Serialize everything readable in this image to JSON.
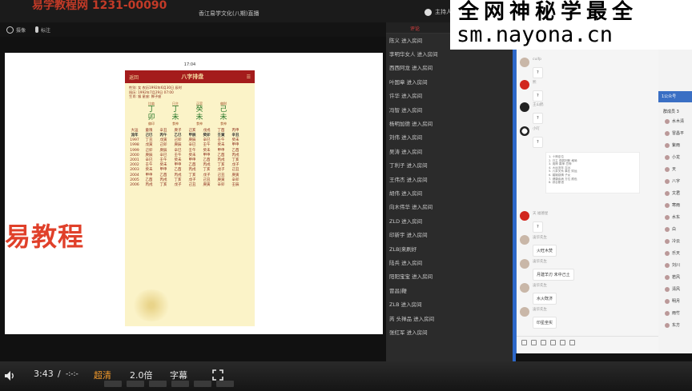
{
  "top": {
    "watermark_text": "易学教程网 1231-00090",
    "title": "香江易学文化(八期)直播",
    "user": "主持人直播中"
  },
  "video_toolbar": {
    "camera_label": "摄像",
    "pin_label": "标注"
  },
  "overlay": {
    "big_text": "易教程"
  },
  "phone": {
    "status_time": "17:04",
    "header_title": "八字排盘",
    "back_label": "返回",
    "lines": [
      "性别: 女  农历1992年6月30日 辰时",
      "阳历: 1992年7月29日 07:00",
      "生肖: 猴  星座: 狮子座"
    ],
    "pillars": [
      {
        "sub": "比肩",
        "gan": "丁",
        "zhi": "卯",
        "sub2": "偏印"
      },
      {
        "sub": "日主",
        "gan": "丁",
        "zhi": "未",
        "sub2": "食神"
      },
      {
        "sub": "正官",
        "gan": "癸",
        "zhi": "未",
        "sub2": "食神"
      },
      {
        "sub": "偏财",
        "gan": "己",
        "zhi": "未",
        "sub2": "食神"
      }
    ],
    "grid": {
      "header": [
        "大运",
        "童限",
        "辛丑",
        "庚子",
        "己亥",
        "戊戌",
        "丁酉",
        "丙申"
      ],
      "highlight": [
        "流年",
        "己巳",
        "丙午",
        "乙巳",
        "甲辰",
        "癸卯",
        "壬寅",
        "辛丑"
      ],
      "rows": [
        [
          "1997",
          "丁丑",
          "戊寅",
          "己卯",
          "庚辰",
          "辛巳",
          "壬午",
          "癸未"
        ],
        [
          "1998",
          "戊寅",
          "己卯",
          "庚辰",
          "辛巳",
          "壬午",
          "癸未",
          "甲申"
        ],
        [
          "1999",
          "己卯",
          "庚辰",
          "辛巳",
          "壬午",
          "癸未",
          "甲申",
          "乙酉"
        ],
        [
          "2000",
          "庚辰",
          "辛巳",
          "壬午",
          "癸未",
          "甲申",
          "乙酉",
          "丙戌"
        ],
        [
          "2001",
          "辛巳",
          "壬午",
          "癸未",
          "甲申",
          "乙酉",
          "丙戌",
          "丁亥"
        ],
        [
          "2002",
          "壬午",
          "癸未",
          "甲申",
          "乙酉",
          "丙戌",
          "丁亥",
          "戊子"
        ],
        [
          "2003",
          "癸未",
          "甲申",
          "乙酉",
          "丙戌",
          "丁亥",
          "戊子",
          "己丑"
        ],
        [
          "2004",
          "甲申",
          "乙酉",
          "丙戌",
          "丁亥",
          "戊子",
          "己丑",
          "庚寅"
        ],
        [
          "2005",
          "乙酉",
          "丙戌",
          "丁亥",
          "戊子",
          "己丑",
          "庚寅",
          "辛卯"
        ],
        [
          "2006",
          "丙戌",
          "丁亥",
          "戊子",
          "己丑",
          "庚寅",
          "辛卯",
          "壬辰"
        ]
      ]
    }
  },
  "controls": {
    "time": "3:43",
    "separator": "/",
    "duration": "-:-:-",
    "quality": "超清",
    "speed": "2.0倍",
    "subtitle": "字幕"
  },
  "chat": {
    "tab_label": "评论",
    "items": [
      "陈义 进入房间",
      "李明华女人 进入房间",
      "西西阿龙 进入房间",
      "叶国章 进入房间",
      "许华 进入房间",
      "冯智 进入房间",
      "杨明加德 进入房间",
      "刘伟 进入房间",
      "吴涛 进入房间",
      "丁利子 进入房间",
      "王伟杰 进入房间",
      "胡伟 进入房间",
      "向木伟华 进入房间",
      "ZLD 进入房间",
      "印新宇 进入房间",
      "ZLB|来刷好",
      "陆兵 进入房间",
      "阳阳宝宝 进入房间",
      "冒昌|鞭",
      "ZLB 进入房间",
      "芮 头禅品 进入房间",
      "张红军 进入房间"
    ]
  },
  "watermark": {
    "line1": "全网神秘学最全",
    "line2": "sm.nayona.cn"
  },
  "wechat": {
    "messages": [
      {
        "name": "cuifp",
        "text": "?"
      },
      {
        "name": "熙",
        "text": "?"
      },
      {
        "name": "王山鹤",
        "text": "?"
      },
      {
        "name": "小叮",
        "text": "?"
      }
    ],
    "doc_lines": [
      "1. 十神定位",
      "2. 日主 强弱判断 格局",
      "3. 用神 喜神 忌神",
      "4. 大运流年 吉凶",
      "5. 六亲关系 事业 财运",
      "6. 婚姻感情 子女",
      "7. 健康疾病 方位 颜色",
      "8. 综合断语"
    ],
    "messages2": [
      {
        "name": "天 福德星",
        "text": "?"
      },
      {
        "name": "凌华先生",
        "text": "火旺木焚"
      },
      {
        "name": "凌华先生",
        "text": "月建羊刃 未中己土"
      },
      {
        "name": "凌华先生",
        "text": "水火既济"
      },
      {
        "name": "凌华先生",
        "text": "印星坐实"
      }
    ]
  },
  "members": {
    "header": "群成员 3",
    "blue_label": "1公众号",
    "names": [
      "水木清",
      "冒昌平",
      "紫雨",
      "小龙",
      "天",
      "八字",
      "文君",
      "寒雨",
      "水东",
      "白",
      "冷云",
      "乐天",
      "刘川",
      "若风",
      "清风",
      "明月",
      "雨竹",
      "东方"
    ]
  }
}
